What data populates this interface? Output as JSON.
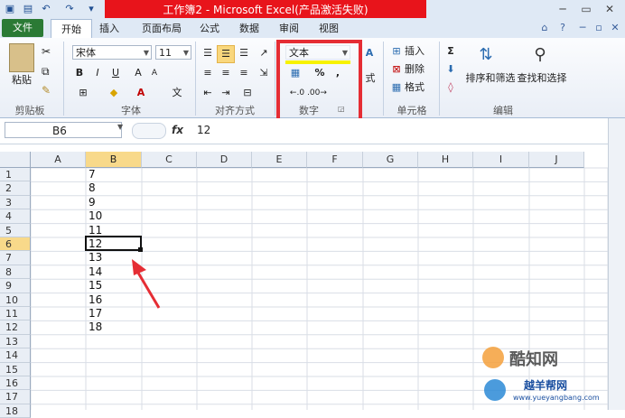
{
  "titlebar": {
    "title": "工作簿2 - Microsoft Excel(产品激活失败)"
  },
  "tabs": [
    "文件",
    "开始",
    "插入",
    "页面布局",
    "公式",
    "数据",
    "审阅",
    "视图"
  ],
  "ribbon": {
    "clipboard": {
      "paste": "粘贴",
      "label": "剪贴板"
    },
    "font": {
      "name": "宋体",
      "size": "11",
      "bold": "B",
      "italic": "I",
      "underline": "U",
      "label": "字体"
    },
    "alignment": {
      "label": "对齐方式"
    },
    "number": {
      "format": "文本",
      "percent": "%",
      "comma": ",",
      "label": "数字"
    },
    "styles": {
      "label": "式"
    },
    "cells": {
      "insert": "插入",
      "delete": "删除",
      "format": "格式",
      "label": "单元格"
    },
    "editing": {
      "sort": "排序和筛选",
      "find": "查找和选择",
      "label": "编辑"
    },
    "colors": {
      "red_box": "#e52d34",
      "highlight": "#f7f200",
      "file_tab": "#2b7a35"
    }
  },
  "formula_bar": {
    "name_box": "B6",
    "fx": "fx",
    "value": "12"
  },
  "columns": [
    "A",
    "B",
    "C",
    "D",
    "E",
    "F",
    "G",
    "H",
    "I",
    "J"
  ],
  "rows": [
    "1",
    "2",
    "3",
    "4",
    "5",
    "6",
    "7",
    "8",
    "9",
    "10",
    "11",
    "12",
    "13",
    "14",
    "15",
    "16",
    "17",
    "18"
  ],
  "column_b_values": [
    "7",
    "8",
    "9",
    "10",
    "11",
    "12",
    "13",
    "14",
    "15",
    "16",
    "17",
    "18"
  ],
  "active_cell": "B6",
  "watermark": {
    "brand": "酷知网",
    "site": "越羊帮网",
    "url": "www.yueyangbang.com"
  }
}
